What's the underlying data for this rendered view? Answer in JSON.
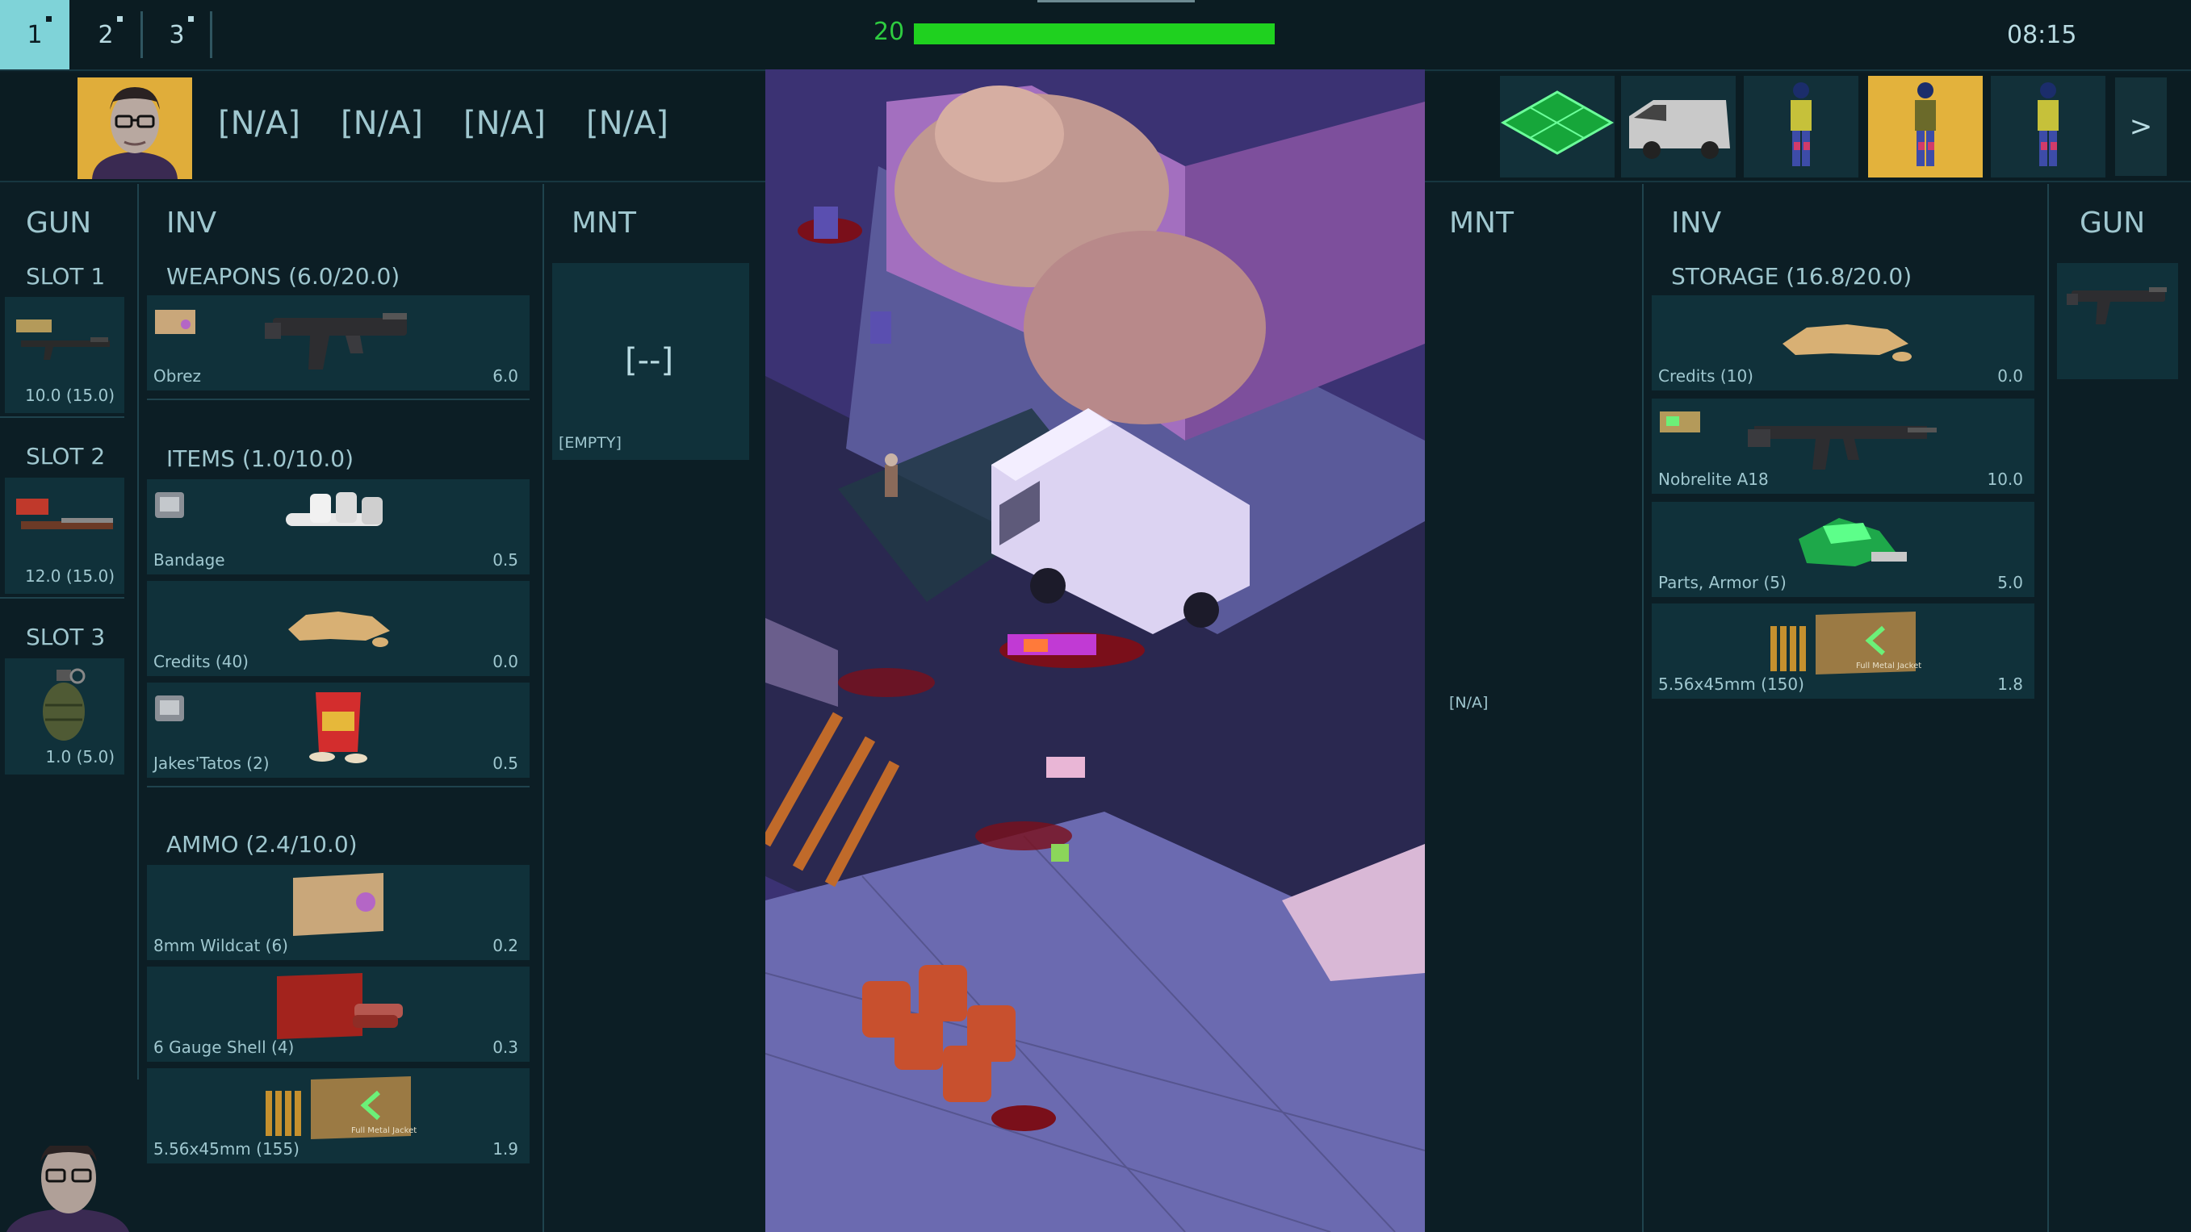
{
  "squad_tabs": [
    {
      "label": "1",
      "active": true
    },
    {
      "label": "2",
      "active": false
    },
    {
      "label": "3",
      "active": false
    }
  ],
  "health": {
    "value": "20",
    "fraction": 1.0
  },
  "clock": "08:15",
  "left_slots_na": [
    "[N/A]",
    "[N/A]",
    "[N/A]",
    "[N/A]"
  ],
  "left": {
    "gun": {
      "title": "GUN",
      "slots": [
        {
          "title": "SLOT 1",
          "weight": "10.0 (15.0)"
        },
        {
          "title": "SLOT 2",
          "weight": "12.0 (15.0)"
        },
        {
          "title": "SLOT 3",
          "weight": "1.0 (5.0)"
        }
      ]
    },
    "inv": {
      "title": "INV",
      "weapons": {
        "title": "WEAPONS (6.0/20.0)",
        "items": [
          {
            "name": "Obrez",
            "weight": "6.0"
          }
        ]
      },
      "items": {
        "title": "ITEMS (1.0/10.0)",
        "items": [
          {
            "name": "Bandage",
            "weight": "0.5"
          },
          {
            "name": "Credits (40)",
            "weight": "0.0"
          },
          {
            "name": "Jakes'Tatos (2)",
            "weight": "0.5"
          }
        ]
      },
      "ammo": {
        "title": "AMMO (2.4/10.0)",
        "items": [
          {
            "name": "8mm Wildcat (6)",
            "weight": "0.2"
          },
          {
            "name": "6 Gauge Shell (4)",
            "weight": "0.3"
          },
          {
            "name": "5.56x45mm (155)",
            "weight": "1.9"
          }
        ]
      }
    },
    "mnt": {
      "title": "MNT",
      "slot_value": "[--]",
      "slot_label": "[EMPTY]"
    }
  },
  "right": {
    "mnt": {
      "title": "MNT",
      "value": "[N/A]"
    },
    "inv": {
      "title": "INV",
      "storage": {
        "title": "STORAGE (16.8/20.0)",
        "items": [
          {
            "name": "Credits (10)",
            "weight": "0.0"
          },
          {
            "name": "Nobrelite A18",
            "weight": "10.0"
          },
          {
            "name": "Parts, Armor (5)",
            "weight": "5.0"
          },
          {
            "name": "5.56x45mm (150)",
            "weight": "1.8"
          }
        ]
      }
    },
    "gun": {
      "title": "GUN"
    }
  },
  "next_label": ">",
  "ammo_box_text": "Full Metal Jacket",
  "colors": {
    "health": "#1fd11f",
    "accent": "#7fd3d8",
    "selected": "#e3b23c",
    "panel": "#10313a"
  }
}
